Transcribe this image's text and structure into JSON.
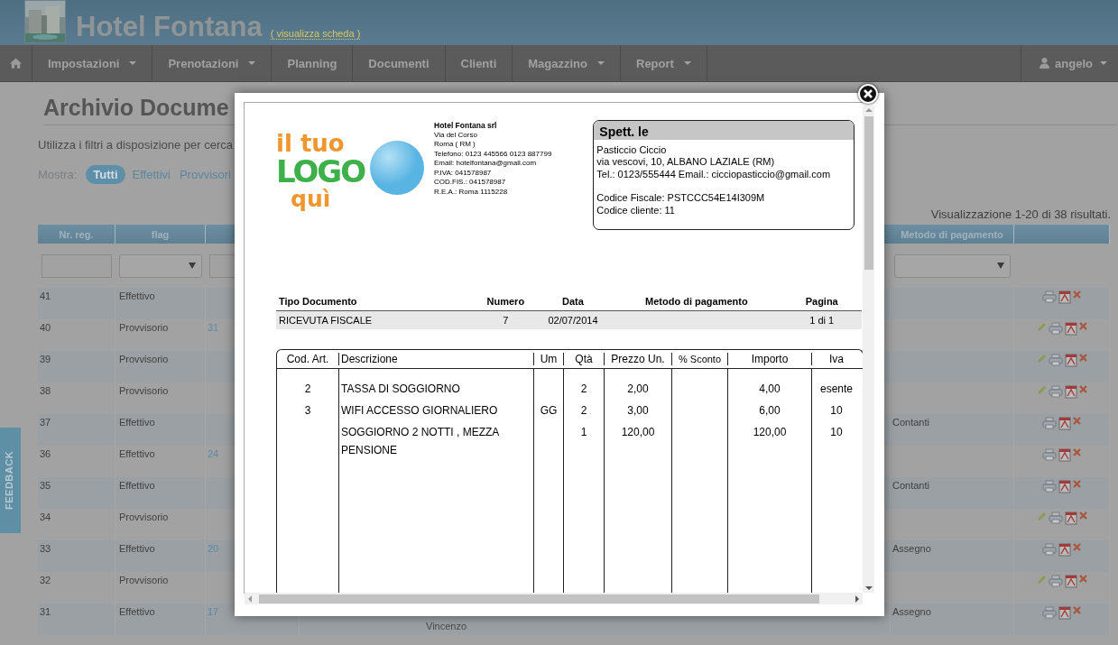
{
  "header": {
    "title": "Hotel Fontana",
    "link": "( visualizza scheda )"
  },
  "nav": {
    "items": [
      {
        "label": "Impostazioni",
        "dropdown": true
      },
      {
        "label": "Prenotazioni",
        "dropdown": true
      },
      {
        "label": "Planning",
        "dropdown": false
      },
      {
        "label": "Documenti",
        "dropdown": false
      },
      {
        "label": "Clienti",
        "dropdown": false
      },
      {
        "label": "Magazzino",
        "dropdown": true
      },
      {
        "label": "Report",
        "dropdown": true
      }
    ],
    "user": "angelo"
  },
  "page": {
    "title": "Archivio Docume",
    "intro": "Utilizza i filtri a disposizione per cerca",
    "filter_label": "Mostra:",
    "filters": [
      {
        "label": "Tutti",
        "selected": true
      },
      {
        "label": "Effettivi",
        "selected": false
      },
      {
        "label": "Provvisori",
        "selected": false
      }
    ],
    "summary": "Visualizzazione 1-20 di 38 risultati."
  },
  "table": {
    "columns": [
      "Nr. reg.",
      "flag",
      "Metodo di pagamento"
    ],
    "rows": [
      {
        "nr": "41",
        "flag": "Effettivo",
        "editable": false
      },
      {
        "nr": "40",
        "flag": "Provvisorio",
        "ref": "31",
        "editable": true
      },
      {
        "nr": "39",
        "flag": "Provvisorio",
        "editable": true
      },
      {
        "nr": "38",
        "flag": "Provvisorio",
        "editable": true
      },
      {
        "nr": "37",
        "flag": "Effettivo",
        "payment": "Contanti",
        "editable": false
      },
      {
        "nr": "36",
        "flag": "Effettivo",
        "ref": "24",
        "editable": false
      },
      {
        "nr": "35",
        "flag": "Effettivo",
        "payment": "Contanti",
        "editable": false
      },
      {
        "nr": "34",
        "flag": "Provvisorio",
        "editable": true
      },
      {
        "nr": "33",
        "flag": "Effettivo",
        "ref": "20",
        "payment": "Assegno",
        "editable": false
      },
      {
        "nr": "32",
        "flag": "Provvisorio",
        "editable": true
      },
      {
        "nr": "31",
        "flag": "Effettivo",
        "ref": "17",
        "payment": "Assegno",
        "client": "Vincenzo",
        "editable": false
      }
    ]
  },
  "feedback": "FEEDBACK",
  "document": {
    "logo": [
      "il tuo",
      "LOGO",
      "quì"
    ],
    "company": {
      "name": "Hotel Fontana srl",
      "lines": [
        "Via del Corso",
        "Roma ( RM )",
        "Telefono: 0123 445566 0123 887799",
        "Email: hotelfontana@gmail.com",
        "P.IVA: 041578987",
        "COD.FIS.: 041578987",
        "R.E.A.: Roma 1115228"
      ]
    },
    "recipient": {
      "heading": "Spett. le",
      "lines": [
        "Pasticcio Ciccio",
        "via vescovi, 10, ALBANO LAZIALE (RM)",
        "Tel.: 0123/555444 Email.: cicciopasticcio@gmail.com"
      ],
      "codes": [
        "Codice Fiscale: PSTCCC54E14I309M",
        "Codice cliente: 11"
      ]
    },
    "meta": [
      {
        "label": "Tipo Documento",
        "value": "RICEVUTA FISCALE"
      },
      {
        "label": "Numero",
        "value": "7"
      },
      {
        "label": "Data",
        "value": "02/07/2014"
      },
      {
        "label": "Metodo di pagamento"
      },
      {
        "label": "Pagina",
        "value": "1 di 1"
      }
    ],
    "items": {
      "columns": [
        "Cod. Art.",
        "Descrizione",
        "Um",
        "Qtà",
        "Prezzo Un.",
        "% Sconto",
        "Importo",
        "Iva"
      ],
      "rows": [
        [
          "2",
          "TASSA DI SOGGIORNO",
          "",
          "2",
          "2,00",
          "",
          "4,00",
          "esente"
        ],
        [
          "3",
          "WIFI ACCESSO GIORNALIERO",
          "GG",
          "2",
          "3,00",
          "",
          "6,00",
          "10"
        ],
        [
          "",
          "SOGGIORNO 2 NOTTI , MEZZA PENSIONE",
          "",
          "1",
          "120,00",
          "",
          "120,00",
          "10"
        ]
      ]
    }
  }
}
